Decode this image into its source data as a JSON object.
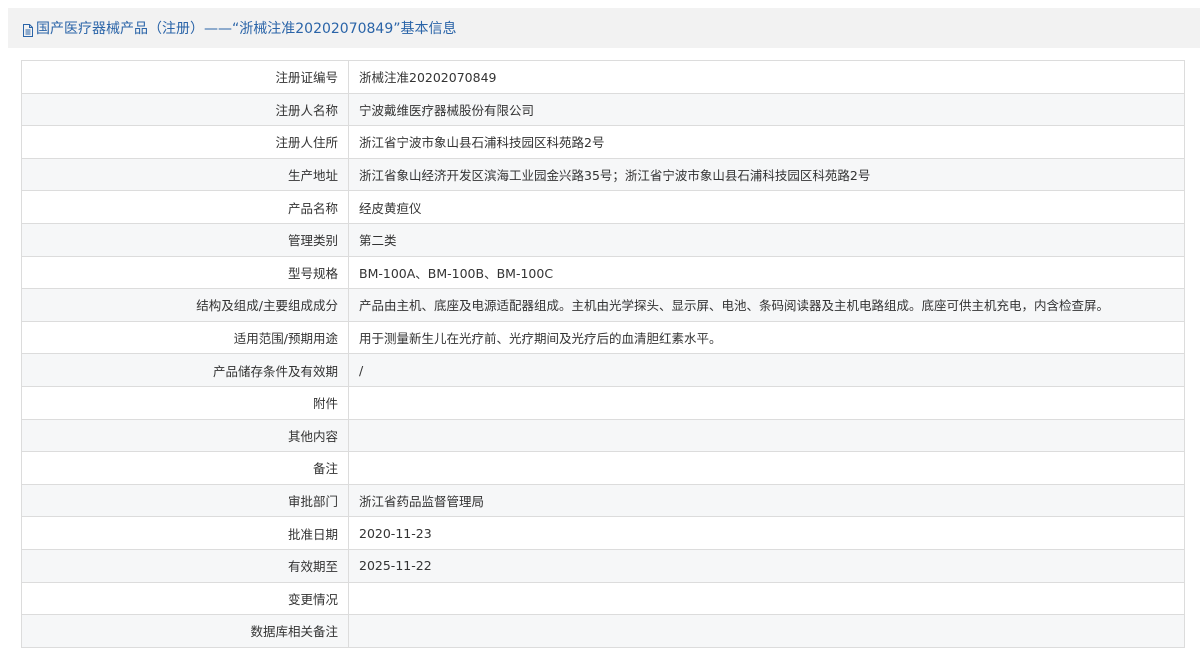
{
  "header": {
    "icon": "document-icon",
    "title": "国产医疗器械产品（注册）——“浙械注准20202070849”基本信息"
  },
  "rows": [
    {
      "label": "注册证编号",
      "value": "浙械注准20202070849"
    },
    {
      "label": "注册人名称",
      "value": "宁波戴维医疗器械股份有限公司"
    },
    {
      "label": "注册人住所",
      "value": "浙江省宁波市象山县石浦科技园区科苑路2号"
    },
    {
      "label": "生产地址",
      "value": "浙江省象山经济开发区滨海工业园金兴路35号；浙江省宁波市象山县石浦科技园区科苑路2号"
    },
    {
      "label": "产品名称",
      "value": "经皮黄疸仪"
    },
    {
      "label": "管理类别",
      "value": "第二类"
    },
    {
      "label": "型号规格",
      "value": "BM-100A、BM-100B、BM-100C"
    },
    {
      "label": "结构及组成/主要组成成分",
      "value": "产品由主机、底座及电源适配器组成。主机由光学探头、显示屏、电池、条码阅读器及主机电路组成。底座可供主机充电，内含检查屏。"
    },
    {
      "label": "适用范围/预期用途",
      "value": "用于测量新生儿在光疗前、光疗期间及光疗后的血清胆红素水平。"
    },
    {
      "label": "产品储存条件及有效期",
      "value": "/"
    },
    {
      "label": "附件",
      "value": ""
    },
    {
      "label": "其他内容",
      "value": ""
    },
    {
      "label": "备注",
      "value": ""
    },
    {
      "label": "审批部门",
      "value": "浙江省药品监督管理局"
    },
    {
      "label": "批准日期",
      "value": "2020-11-23"
    },
    {
      "label": "有效期至",
      "value": "2025-11-22"
    },
    {
      "label": "变更情况",
      "value": ""
    },
    {
      "label": "数据库相关备注",
      "value": ""
    }
  ]
}
